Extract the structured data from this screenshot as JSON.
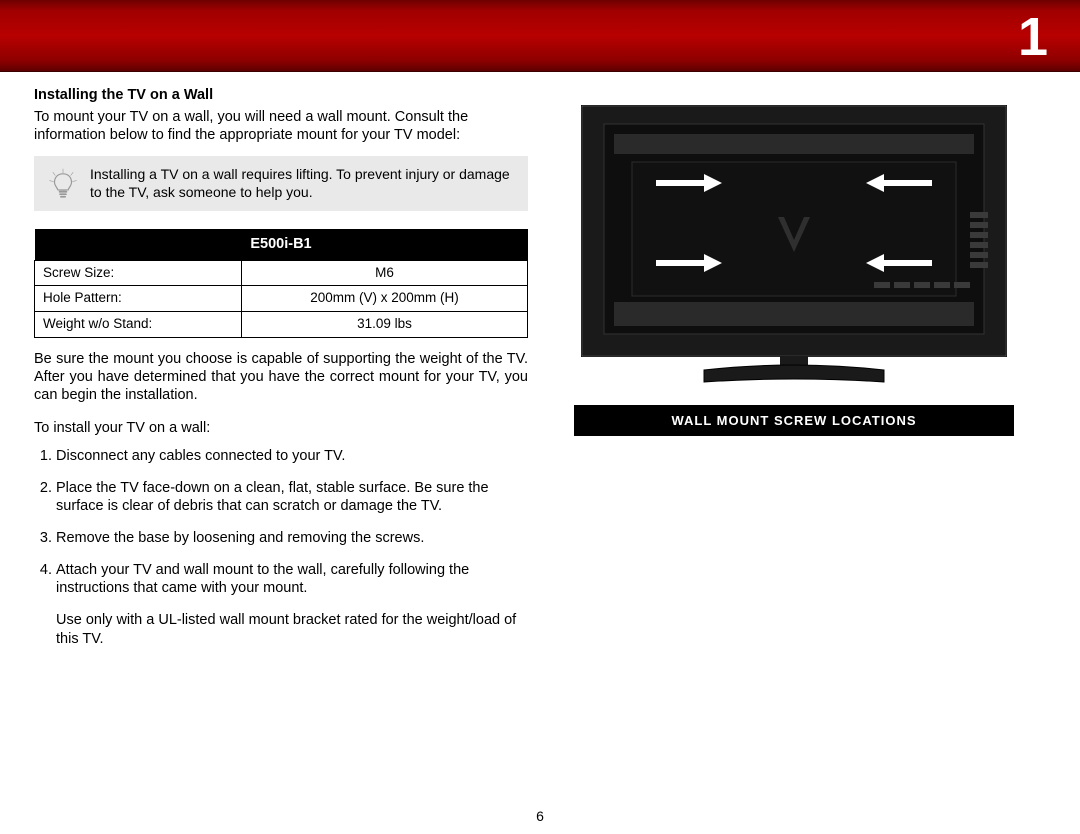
{
  "chapter_number": "1",
  "section_heading": "Installing the TV on a Wall",
  "intro_paragraph": "To mount your TV on a wall, you will need a wall mount. Consult the information below to find the appropriate mount for your TV model:",
  "tip_text": "Installing a TV on a wall requires lifting. To prevent injury or damage to the TV, ask someone to help you.",
  "spec_table": {
    "header": "E500i-B1",
    "rows": [
      {
        "label": "Screw Size:",
        "value": "M6"
      },
      {
        "label": "Hole Pattern:",
        "value": "200mm (V) x 200mm (H)"
      },
      {
        "label": "Weight w/o Stand:",
        "value": "31.09 lbs"
      }
    ]
  },
  "after_table_paragraph": "Be sure the mount you choose is capable of supporting the weight of the TV. After you have determined that you have the correct mount for your TV, you can begin the installation.",
  "pre_list_text": "To install your TV on a wall:",
  "steps": [
    "Disconnect any cables connected to your TV.",
    "Place the TV face-down on a clean, flat, stable surface. Be sure the surface is clear of debris that can scratch or damage the TV.",
    "Remove the base by loosening and removing the screws.",
    "Attach your TV and wall mount to the wall, carefully following the instructions that came with your mount."
  ],
  "step_note": "Use only with a UL-listed wall mount bracket rated for the weight/load of this TV.",
  "figure_caption": "WALL MOUNT SCREW LOCATIONS",
  "page_number": "6"
}
